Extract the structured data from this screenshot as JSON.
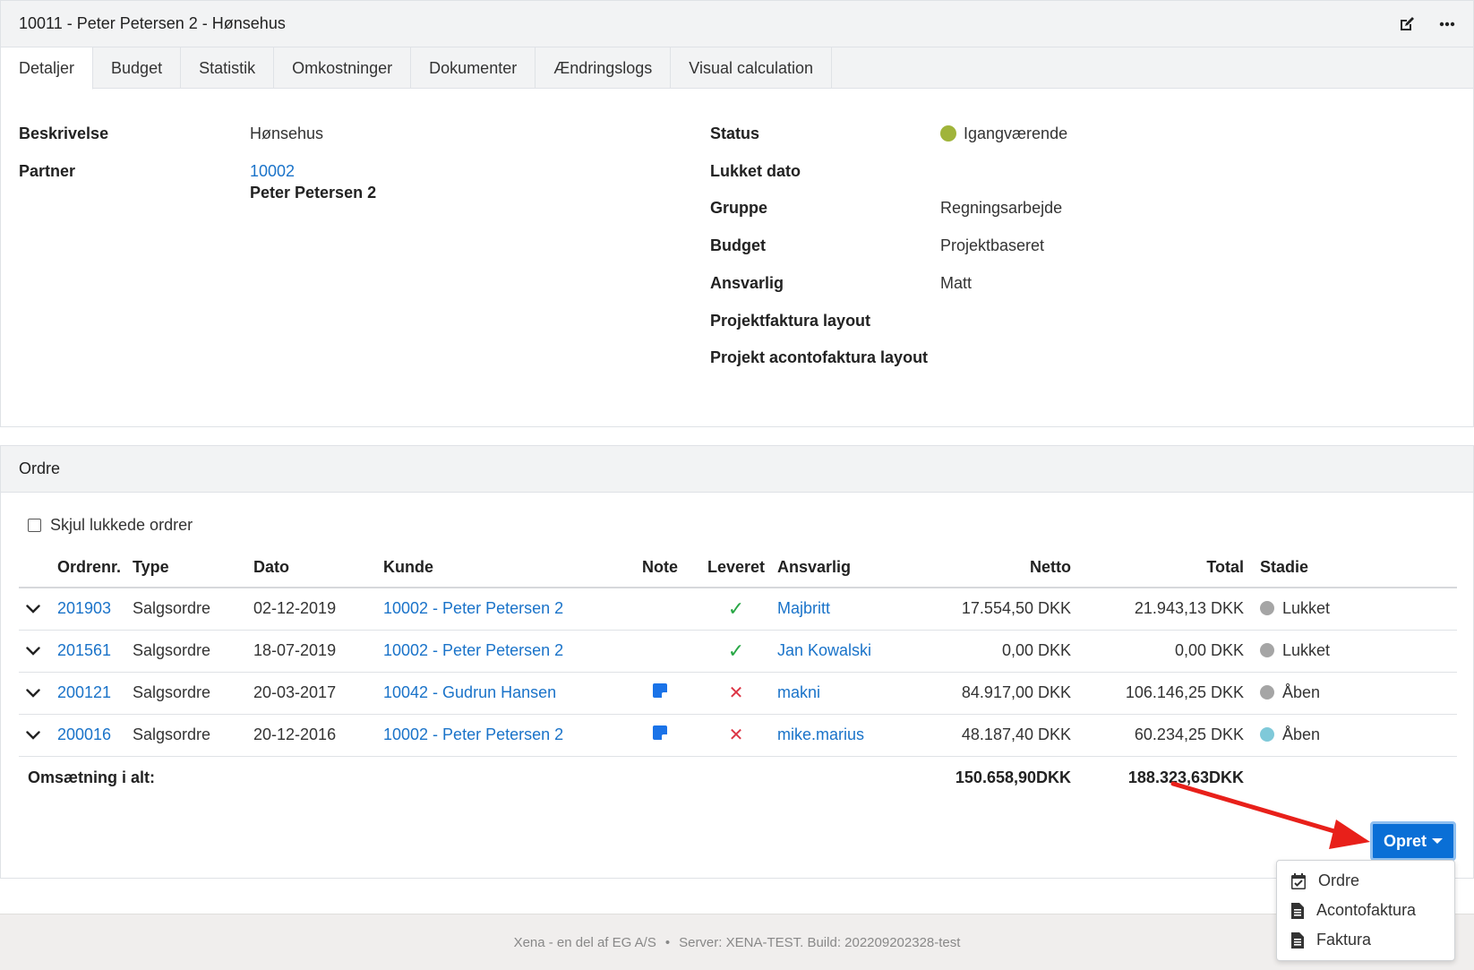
{
  "header": {
    "title": "10011 - Peter Petersen 2 - Hønsehus"
  },
  "icons": {
    "edit": "edit-icon",
    "more": "more-icon"
  },
  "tabs": [
    {
      "label": "Detaljer",
      "active": true
    },
    {
      "label": "Budget"
    },
    {
      "label": "Statistik"
    },
    {
      "label": "Omkostninger"
    },
    {
      "label": "Dokumenter"
    },
    {
      "label": "Ændringslogs"
    },
    {
      "label": "Visual calculation"
    }
  ],
  "details": {
    "beskrivelse_label": "Beskrivelse",
    "beskrivelse_value": "Hønsehus",
    "partner_label": "Partner",
    "partner_id": "10002",
    "partner_name": "Peter Petersen 2",
    "status_label": "Status",
    "status_value": "Igangværende",
    "status_color": "#a0b43a",
    "lukket_dato_label": "Lukket dato",
    "gruppe_label": "Gruppe",
    "gruppe_value": "Regningsarbejde",
    "budget_label": "Budget",
    "budget_value": "Projektbaseret",
    "ansvarlig_label": "Ansvarlig",
    "ansvarlig_value": "Matt",
    "projektfaktura_layout_label": "Projektfaktura layout",
    "projekt_acontofaktura_layout_label": "Projekt acontofaktura layout"
  },
  "orders": {
    "section_title": "Ordre",
    "hide_closed_label": "Skjul lukkede ordrer",
    "columns": {
      "ordrenr": "Ordrenr.",
      "type": "Type",
      "dato": "Dato",
      "kunde": "Kunde",
      "note": "Note",
      "leveret": "Leveret",
      "ansvarlig": "Ansvarlig",
      "netto": "Netto",
      "total": "Total",
      "stadie": "Stadie"
    },
    "rows": [
      {
        "ordrenr": "201903",
        "type": "Salgsordre",
        "dato": "02-12-2019",
        "kunde": "10002 - Peter Petersen 2",
        "note": false,
        "leveret": true,
        "ansvarlig": "Majbritt",
        "netto": "17.554,50 DKK",
        "total": "21.943,13 DKK",
        "stadie": "Lukket",
        "stadie_color": "#a5a5a5"
      },
      {
        "ordrenr": "201561",
        "type": "Salgsordre",
        "dato": "18-07-2019",
        "kunde": "10002 - Peter Petersen 2",
        "note": false,
        "leveret": true,
        "ansvarlig": "Jan Kowalski",
        "netto": "0,00 DKK",
        "total": "0,00 DKK",
        "stadie": "Lukket",
        "stadie_color": "#a5a5a5"
      },
      {
        "ordrenr": "200121",
        "type": "Salgsordre",
        "dato": "20-03-2017",
        "kunde": "10042 - Gudrun Hansen",
        "note": true,
        "leveret": false,
        "ansvarlig": "makni",
        "netto": "84.917,00 DKK",
        "total": "106.146,25 DKK",
        "stadie": "Åben",
        "stadie_color": "#a5a5a5"
      },
      {
        "ordrenr": "200016",
        "type": "Salgsordre",
        "dato": "20-12-2016",
        "kunde": "10002 - Peter Petersen 2",
        "note": true,
        "leveret": false,
        "ansvarlig": "mike.marius",
        "netto": "48.187,40 DKK",
        "total": "60.234,25 DKK",
        "stadie": "Åben",
        "stadie_color": "#7fc9d9"
      }
    ],
    "total_label": "Omsætning i alt:",
    "total_netto": "150.658,90DKK",
    "total_total": "188.323,63DKK"
  },
  "opret": {
    "button_label": "Opret",
    "menu": [
      {
        "label": "Ordre",
        "icon": "calendar-check-icon"
      },
      {
        "label": "Acontofaktura",
        "icon": "file-text-icon"
      },
      {
        "label": "Faktura",
        "icon": "file-text-icon"
      }
    ]
  },
  "annotation": {
    "arrow_color": "#e8201a"
  },
  "footer": {
    "brand": "Xena - en del af EG A/S",
    "separator": "•",
    "server": "Server: XENA-TEST. Build: 202209202328-test"
  }
}
